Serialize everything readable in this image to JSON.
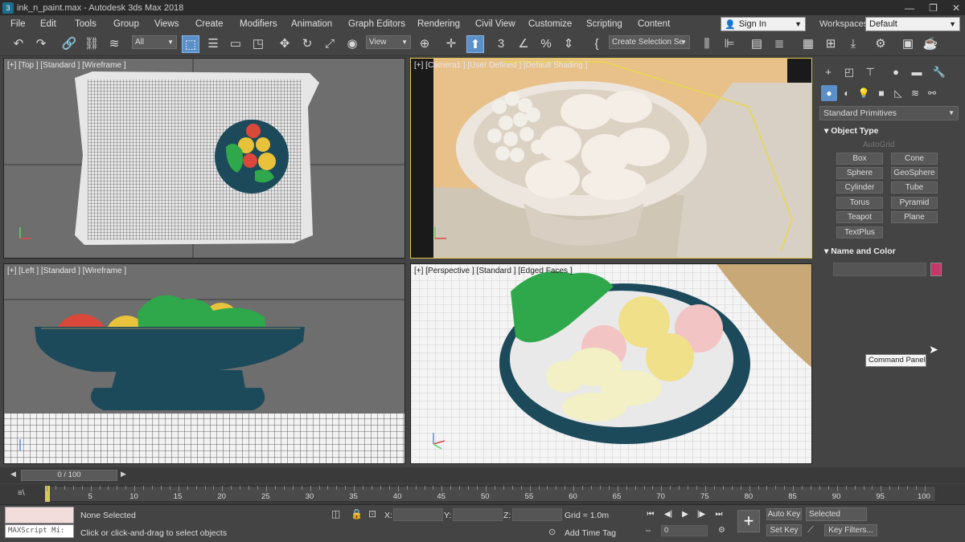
{
  "window": {
    "title": "ink_n_paint.max - Autodesk 3ds Max 2018",
    "minimize": "—",
    "restore": "❐",
    "close": "✕"
  },
  "menu": {
    "items": [
      "File",
      "Edit",
      "Tools",
      "Group",
      "Views",
      "Create",
      "Modifiers",
      "Animation",
      "Graph Editors",
      "Rendering",
      "Civil View",
      "Customize",
      "Scripting",
      "Content"
    ],
    "sign_in": "Sign In",
    "workspaces_label": "Workspaces:",
    "workspace_value": "Default"
  },
  "toolbar": {
    "filter_value": "All",
    "ref_coord_value": "View",
    "selection_set_value": "Create Selection Se"
  },
  "viewports": {
    "top_label": "[+] [Top ] [Standard ] [Wireframe ]",
    "camera_label": "[+] [Camera1 ] [User Defined ] [Default Shading ]",
    "left_label": "[+] [Left ] [Standard ] [Wireframe ]",
    "perspective_label": "[+] [Perspective ] [Standard ] [Edged Faces ]"
  },
  "command_panel": {
    "category_value": "Standard Primitives",
    "object_type_header": "Object Type",
    "autogrid_label": "AutoGrid",
    "primitives": [
      "Box",
      "Cone",
      "Sphere",
      "GeoSphere",
      "Cylinder",
      "Tube",
      "Torus",
      "Pyramid",
      "Teapot",
      "Plane",
      "TextPlus"
    ],
    "name_color_header": "Name and Color",
    "object_color": "#c4386a",
    "tooltip": "Command Panel"
  },
  "timeline": {
    "slider_text": "0 / 100",
    "current_frame": 0,
    "total_frames": 100,
    "ticks": [
      5,
      10,
      15,
      20,
      25,
      30,
      35,
      40,
      45,
      50,
      55,
      60,
      65,
      70,
      75,
      80,
      85,
      90,
      95,
      100
    ]
  },
  "status": {
    "listener_label": "MAXScript Mi:",
    "selection": "None Selected",
    "prompt": "Click or click-and-drag to select objects",
    "x_label": "X:",
    "y_label": "Y:",
    "z_label": "Z:",
    "grid": "Grid = 1.0m",
    "add_time_tag": "Add Time Tag",
    "frame_value": "0",
    "auto_key": "Auto Key",
    "set_key": "Set Key",
    "selected_value": "Selected",
    "key_filters": "Key Filters..."
  }
}
